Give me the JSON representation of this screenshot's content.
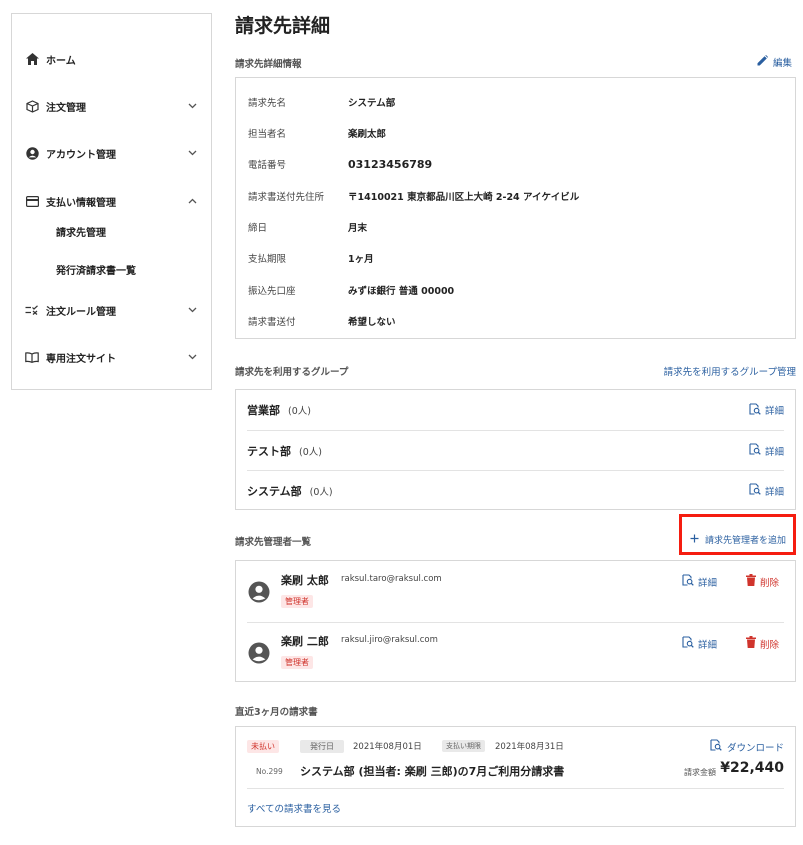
{
  "sidebar": {
    "items": [
      {
        "label": "ホーム",
        "icon": "home-icon"
      },
      {
        "label": "注文管理",
        "icon": "box-icon"
      },
      {
        "label": "アカウント管理",
        "icon": "account-icon"
      },
      {
        "label": "支払い情報管理",
        "icon": "credit-card-icon"
      },
      {
        "label": "注文ルール管理",
        "icon": "rule-check-icon"
      },
      {
        "label": "専用注文サイト",
        "icon": "book-icon"
      }
    ],
    "sub_items": [
      {
        "label": "請求先管理"
      },
      {
        "label": "発行済請求書一覧"
      }
    ]
  },
  "page": {
    "title": "請求先詳細"
  },
  "detail": {
    "section_title": "請求先詳細情報",
    "edit_label": "編集",
    "rows": [
      {
        "label": "請求先名",
        "value": "システム部"
      },
      {
        "label": "担当者名",
        "value": "楽刷太郎"
      },
      {
        "label": "電話番号",
        "value": "03123456789"
      },
      {
        "label": "請求書送付先住所",
        "value": "〒1410021 東京都品川区上大崎 2-24 アイケイビル"
      },
      {
        "label": "締日",
        "value": "月末"
      },
      {
        "label": "支払期限",
        "value": "1ヶ月"
      },
      {
        "label": "振込先口座",
        "value": "みずほ銀行 普通 00000"
      },
      {
        "label": "請求書送付",
        "value": "希望しない"
      }
    ]
  },
  "groups": {
    "section_title": "請求先を利用するグループ",
    "manage_label": "請求先を利用するグループ管理",
    "detail_label": "詳細",
    "items": [
      {
        "name": "営業部",
        "count": "(0人)"
      },
      {
        "name": "テスト部",
        "count": "(0人)"
      },
      {
        "name": "システム部",
        "count": "(0人)"
      }
    ]
  },
  "admins": {
    "section_title": "請求先管理者一覧",
    "add_label": "請求先管理者を追加",
    "detail_label": "詳細",
    "delete_label": "削除",
    "items": [
      {
        "name": "楽刷 太郎",
        "email": "raksul.taro@raksul.com",
        "role": "管理者"
      },
      {
        "name": "楽刷 二郎",
        "email": "raksul.jiro@raksul.com",
        "role": "管理者"
      }
    ]
  },
  "invoices": {
    "section_title": "直近3ヶ月の請求書",
    "status": "未払い",
    "issue_label": "発行日",
    "issue_date": "2021年08月01日",
    "due_label": "支払い期限",
    "due_date": "2021年08月31日",
    "download_label": "ダウンロード",
    "number": "No.299",
    "title": "システム部 (担当者: 楽刷 三郎)の7月ご利用分請求書",
    "amount_label": "請求金額",
    "amount": "¥22,440",
    "view_all_label": "すべての請求書を見る"
  },
  "colors": {
    "link": "#2a5fa0",
    "danger": "#d0342c",
    "highlight": "#f51d10"
  }
}
